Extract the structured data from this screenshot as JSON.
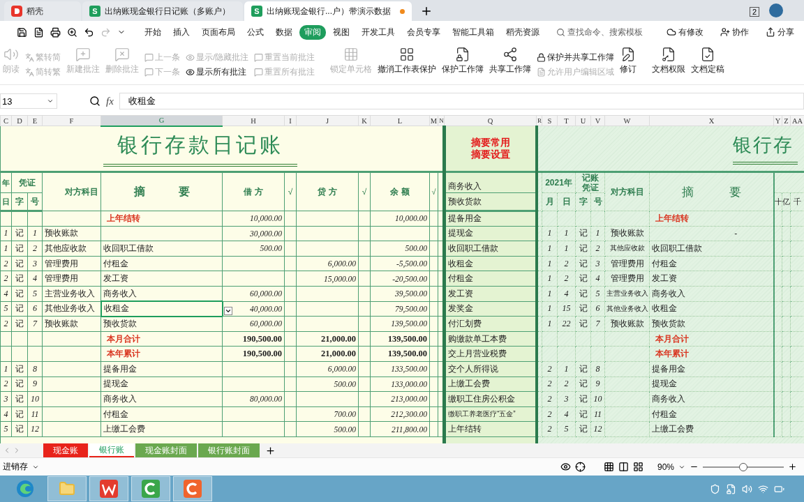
{
  "browser_tabs": [
    {
      "label": "稻壳",
      "selected": false,
      "kind": "docer",
      "modified": false
    },
    {
      "label": "出纳账现金银行日记账（多账户）",
      "selected": false,
      "kind": "sheet",
      "badge": "S",
      "modified": false
    },
    {
      "label": "出纳账现金银行...户）带演示数据",
      "selected": true,
      "kind": "sheet",
      "badge": "S",
      "modified": true
    }
  ],
  "window_badge": "2",
  "menu_tabs": [
    {
      "label": "开始",
      "selected": false
    },
    {
      "label": "插入",
      "selected": false
    },
    {
      "label": "页面布局",
      "selected": false
    },
    {
      "label": "公式",
      "selected": false
    },
    {
      "label": "数据",
      "selected": false
    },
    {
      "label": "审阅",
      "selected": true
    },
    {
      "label": "视图",
      "selected": false
    },
    {
      "label": "开发工具",
      "selected": false
    },
    {
      "label": "会员专享",
      "selected": false
    },
    {
      "label": "智能工具箱",
      "selected": false
    },
    {
      "label": "稻壳资源",
      "selected": false
    }
  ],
  "search": {
    "placeholder": "查找命令、搜索模板"
  },
  "header_actions": [
    "有修改",
    "协作",
    "分享"
  ],
  "ribbon": [
    {
      "kind": "large",
      "items": [
        {
          "label": "朗读",
          "disabled": true
        }
      ]
    },
    {
      "kind": "small",
      "items": [
        {
          "label": "繁转简",
          "disabled": true
        },
        {
          "label": "简转繁",
          "disabled": true
        }
      ]
    },
    {
      "kind": "large",
      "items": [
        {
          "label": "新建批注",
          "disabled": true
        }
      ]
    },
    {
      "kind": "large",
      "items": [
        {
          "label": "删除批注",
          "disabled": true
        }
      ]
    },
    {
      "kind": "small",
      "items": [
        {
          "label": "上一条",
          "disabled": true
        },
        {
          "label": "下一条",
          "disabled": true
        }
      ]
    },
    {
      "kind": "small",
      "items": [
        {
          "label": "显示/隐藏批注",
          "disabled": true
        },
        {
          "label": "显示所有批注",
          "disabled": false
        }
      ]
    },
    {
      "kind": "small",
      "items": [
        {
          "label": "重置当前批注",
          "disabled": true
        },
        {
          "label": "重置所有批注",
          "disabled": true
        }
      ]
    },
    {
      "kind": "large",
      "items": [
        {
          "label": "锁定单元格",
          "disabled": true
        }
      ]
    },
    {
      "kind": "large",
      "items": [
        {
          "label": "撤消工作表保护",
          "disabled": false
        }
      ]
    },
    {
      "kind": "large",
      "items": [
        {
          "label": "保护工作簿",
          "disabled": false
        }
      ]
    },
    {
      "kind": "large",
      "items": [
        {
          "label": "共享工作簿",
          "disabled": false
        }
      ]
    },
    {
      "kind": "small",
      "items": [
        {
          "label": "保护并共享工作簿",
          "disabled": false
        },
        {
          "label": "允许用户编辑区域",
          "disabled": true
        }
      ]
    },
    {
      "kind": "large",
      "items": [
        {
          "label": "修订",
          "disabled": false
        }
      ]
    },
    {
      "kind": "large",
      "items": [
        {
          "label": "文档权限",
          "disabled": false
        }
      ]
    },
    {
      "kind": "large",
      "items": [
        {
          "label": "文档定稿",
          "disabled": false
        }
      ]
    }
  ],
  "name_box": "13",
  "function_label": "fx",
  "formula": "收租金",
  "columns": [
    {
      "label": "C",
      "selected": false
    },
    {
      "label": "D",
      "selected": false
    },
    {
      "label": "E",
      "selected": false
    },
    {
      "label": "F",
      "selected": false
    },
    {
      "label": "G",
      "selected": true
    },
    {
      "label": "H",
      "selected": false
    },
    {
      "label": "I",
      "selected": false
    },
    {
      "label": "J",
      "selected": false
    },
    {
      "label": "K",
      "selected": false
    },
    {
      "label": "L",
      "selected": false
    },
    {
      "label": "M",
      "selected": false
    },
    {
      "label": "N",
      "selected": false
    },
    {
      "label": "Q",
      "selected": false
    },
    {
      "label": "R",
      "selected": false
    },
    {
      "label": "S",
      "selected": false
    },
    {
      "label": "T",
      "selected": false
    },
    {
      "label": "U",
      "selected": false
    },
    {
      "label": "V",
      "selected": false
    },
    {
      "label": "W",
      "selected": false
    },
    {
      "label": "X",
      "selected": false
    },
    {
      "label": "Y",
      "selected": false
    },
    {
      "label": "Z",
      "selected": false
    },
    {
      "label": "AA",
      "selected": false
    }
  ],
  "left_ledger": {
    "title": "银行存款日记账",
    "headers": {
      "year": "年",
      "voucher": "凭证",
      "account": "对方科目",
      "summary": "摘　　　要",
      "debit": "借 方",
      "checks": [
        "√",
        "√",
        "√"
      ],
      "credit": "贷 方",
      "balance": "余 额",
      "day": "日",
      "zi": "字",
      "no": "号"
    }
  },
  "q_panel": {
    "links": [
      "摘要常用",
      "摘要设置"
    ],
    "header_items": [
      "商务收入",
      "预收货款"
    ]
  },
  "right_ledger": {
    "title": "银行存",
    "headers": {
      "year": "2021年",
      "voucher": "记账凭证",
      "account": "对方科目",
      "summary": "摘　　　要",
      "month": "月",
      "day": "日",
      "zi": "字",
      "no": "号",
      "units": [
        "十",
        "亿",
        "千"
      ]
    }
  },
  "rows": [
    {
      "kind": "carry",
      "left": {
        "summary": "上年结转",
        "debit": "10,000.00",
        "balance": "10,000.00",
        "selected": false
      },
      "q": "提备用金",
      "right": {
        "summary": "上年结转"
      }
    },
    {
      "kind": "entry",
      "left": {
        "day": "1",
        "zi": "记",
        "no": "1",
        "account": "预收账款",
        "debit": "30,000.00",
        "selected": false
      },
      "q": "提现金",
      "right": {
        "month": "1",
        "day": "1",
        "zi": "记",
        "no": "1",
        "account": "预收账款",
        "mark": "-"
      }
    },
    {
      "kind": "entry",
      "left": {
        "day": "1",
        "zi": "记",
        "no": "2",
        "account": "其他应收款",
        "summary": "收回职工借款",
        "debit": "500.00",
        "balance": "500.00",
        "selected": false
      },
      "q": "收回职工借款",
      "right": {
        "month": "1",
        "day": "1",
        "zi": "记",
        "no": "2",
        "account": "其他应收款",
        "summary": "收回职工借款"
      }
    },
    {
      "kind": "entry",
      "left": {
        "day": "2",
        "zi": "记",
        "no": "3",
        "account": "管理费用",
        "summary": "付租金",
        "credit": "6,000.00",
        "balance": "-5,500.00",
        "selected": false
      },
      "q": "收租金",
      "right": {
        "month": "1",
        "day": "2",
        "zi": "记",
        "no": "3",
        "account": "管理费用",
        "summary": "付租金"
      }
    },
    {
      "kind": "entry",
      "left": {
        "day": "2",
        "zi": "记",
        "no": "4",
        "account": "管理费用",
        "summary": "发工资",
        "credit": "15,000.00",
        "balance": "-20,500.00",
        "selected": false
      },
      "q": "付租金",
      "right": {
        "month": "1",
        "day": "2",
        "zi": "记",
        "no": "4",
        "account": "管理费用",
        "summary": "发工资"
      }
    },
    {
      "kind": "entry",
      "left": {
        "day": "4",
        "zi": "记",
        "no": "5",
        "account": "主营业务收入",
        "summary": "商务收入",
        "debit": "60,000.00",
        "balance": "39,500.00",
        "selected": false
      },
      "q": "发工资",
      "right": {
        "month": "1",
        "day": "4",
        "zi": "记",
        "no": "5",
        "account": "主营业务收入",
        "summary": "商务收入"
      }
    },
    {
      "kind": "entry",
      "left": {
        "day": "5",
        "zi": "记",
        "no": "6",
        "account": "其他业务收入",
        "summary": "收租金",
        "debit": "40,000.00",
        "balance": "79,500.00",
        "selected": true
      },
      "q": "发奖金",
      "right": {
        "month": "1",
        "day": "15",
        "zi": "记",
        "no": "6",
        "account": "其他业务收入",
        "summary": "收租金"
      }
    },
    {
      "kind": "entry",
      "left": {
        "day": "2",
        "zi": "记",
        "no": "7",
        "account": "预收账款",
        "summary": "预收货款",
        "debit": "60,000.00",
        "balance": "139,500.00",
        "selected": false
      },
      "q": "付汇划费",
      "right": {
        "month": "1",
        "day": "22",
        "zi": "记",
        "no": "7",
        "account": "预收账款",
        "summary": "预收货款"
      }
    },
    {
      "kind": "total",
      "left": {
        "summary": "本月合计",
        "debit": "190,500.00",
        "credit": "21,000.00",
        "balance": "139,500.00",
        "selected": false
      },
      "q": "购缴款单工本费",
      "right": {
        "summary": "本月合计"
      }
    },
    {
      "kind": "total",
      "left": {
        "summary": "本年累计",
        "debit": "190,500.00",
        "credit": "21,000.00",
        "balance": "139,500.00",
        "selected": false
      },
      "q": "交上月营业税费",
      "right": {
        "summary": "本年累计"
      }
    },
    {
      "kind": "entry",
      "left": {
        "day": "1",
        "zi": "记",
        "no": "8",
        "summary": "提备用金",
        "credit": "6,000.00",
        "balance": "133,500.00",
        "selected": false
      },
      "q": "交个人所得说",
      "right": {
        "month": "2",
        "day": "1",
        "zi": "记",
        "no": "8",
        "summary": "提备用金"
      }
    },
    {
      "kind": "entry",
      "left": {
        "day": "2",
        "zi": "记",
        "no": "9",
        "summary": "提现金",
        "credit": "500.00",
        "balance": "133,000.00",
        "selected": false
      },
      "q": "上缴工会费",
      "right": {
        "month": "2",
        "day": "2",
        "zi": "记",
        "no": "9",
        "summary": "提现金"
      }
    },
    {
      "kind": "entry",
      "left": {
        "day": "3",
        "zi": "记",
        "no": "10",
        "summary": "商务收入",
        "debit": "80,000.00",
        "balance": "213,000.00",
        "selected": false
      },
      "q": "缴职工住房公积金",
      "right": {
        "month": "2",
        "day": "3",
        "zi": "记",
        "no": "10",
        "summary": "商务收入"
      }
    },
    {
      "kind": "entry",
      "left": {
        "day": "4",
        "zi": "记",
        "no": "11",
        "summary": "付租金",
        "credit": "700.00",
        "balance": "212,300.00",
        "selected": false
      },
      "q": "缴职工养老医疗“五金”",
      "right": {
        "month": "2",
        "day": "4",
        "zi": "记",
        "no": "11",
        "summary": "付租金"
      }
    },
    {
      "kind": "entry",
      "left": {
        "day": "5",
        "zi": "记",
        "no": "12",
        "summary": "上缴工会费",
        "credit": "500.00",
        "balance": "211,800.00",
        "selected": false
      },
      "q": "上年结转",
      "right": {
        "month": "2",
        "day": "5",
        "zi": "记",
        "no": "12",
        "summary": "上缴工会费"
      }
    }
  ],
  "sheet_tabs": [
    {
      "label": "现金账",
      "selected": false,
      "color": "#e8231a"
    },
    {
      "label": "银行账",
      "selected": true,
      "color": "#ffffff"
    },
    {
      "label": "现金账封面",
      "selected": false,
      "color": "#6aa84f"
    },
    {
      "label": "银行账封面",
      "selected": false,
      "color": "#6aa84f"
    }
  ],
  "status_bar": {
    "label": "进销存",
    "zoom": "90%",
    "level": 0.5
  },
  "taskbar": [
    {
      "kind": "edge",
      "active": false
    },
    {
      "kind": "folder",
      "active": true
    },
    {
      "kind": "wps",
      "active": true
    },
    {
      "kind": "green",
      "active": true
    },
    {
      "kind": "orange",
      "active": true
    }
  ]
}
